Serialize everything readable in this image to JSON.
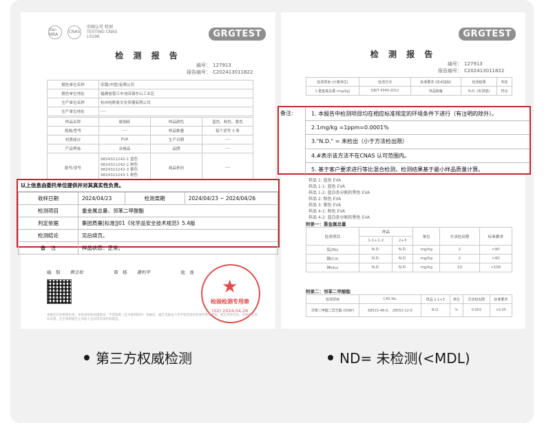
{
  "left_report": {
    "title": "检 测 报 告",
    "brand_logo": "GRGTEST",
    "cert_marks": [
      "ilac-MRA",
      "CNAS",
      "中国认可 检测 TESTING CNAS L0196"
    ],
    "report_no_label": "编号：",
    "report_no": "127913",
    "report_id_label": "报告编号：",
    "report_id": "C202413011822",
    "info_rows": [
      {
        "k": "报告单位名称",
        "v": "安踏(中国)有限公司"
      },
      {
        "k": "报告单位地址",
        "v": "福建省晋江市池店镇东山工业区"
      },
      {
        "k": "生产单位名称",
        "v": "杭州哈默曼文化传播有限公司"
      },
      {
        "k": "生产单位地址",
        "v": "----"
      }
    ],
    "sample_rows": [
      {
        "a": "样品名称",
        "b": "瑜伽砖",
        "c": "样品颜色",
        "d": "蓝色、粉色、紫色"
      },
      {
        "a": "规格/型号",
        "b": "----",
        "c": "样品数量",
        "d": "每个货号 3 条"
      },
      {
        "a": "材质成分",
        "b": "EVA",
        "c": "生产日期",
        "d": "----"
      },
      {
        "a": "产品等级",
        "b": "合格品",
        "c": "品牌",
        "d": "----"
      }
    ],
    "model_label": "款号/货号",
    "model_values": [
      "9824321242-1 蓝色",
      "9824321242-2 粉色",
      "9824321242-3 紫色",
      "9824321243-1 粉色"
    ],
    "trademark_label": "商品条码",
    "trademark_value": "----",
    "highlight_header": "以上信息由委托单位提供并对其真实性负责。",
    "highlight_rows": [
      {
        "k": "收样日期",
        "v": "2024/04/23",
        "k2": "检测周期",
        "v2": "2024/04/23 ~ 2024/04/26"
      },
      {
        "k": "检测项目",
        "v": "重金属总量、邻苯二甲酸酯"
      },
      {
        "k": "判定依据",
        "v": "集团质量[标准]J01《化学品安全技术规范》5.4版"
      },
      {
        "k": "检测结论",
        "v": "见后续页。"
      },
      {
        "k": "备　注",
        "v": "样品状态：正常。"
      }
    ],
    "sign_labels": [
      "编　制",
      "审　核",
      "批　准"
    ],
    "sign_names": [
      "蔡立松",
      "唐利平",
      ""
    ],
    "stamp_text": "检验检测专用章",
    "stamp_num": "(02)",
    "stamp_date": "2024.04.26",
    "footer_text": "本报告仅对来样负责，未经本机构书面批准，不得复制（全文复制除外）本报告。报告无批准人签字或无检验检测专用章无效，报告涂改无效。对本报告有异议者，应于收到报告之日起十五日内向本机构提出。"
  },
  "right_report": {
    "title": "检 测 报 告",
    "brand_logo": "GRGTEST",
    "report_no_label": "编号：",
    "report_no": "127913",
    "report_id_label": "报告编号：",
    "report_id": "C202413011822",
    "top_table_head": [
      "检测项目\n(计量单位)",
      "检测方法",
      "标准要求\n(技术指标)",
      "检测结果",
      "判定"
    ],
    "top_table_row": [
      "1.重金属总量 (mg/kg)",
      "QB/T 4340-2012",
      "样品制备",
      "N.D.\n(实测值)",
      "符合"
    ],
    "note_label": "备注:",
    "notes": [
      "1.  本报告中检测项目均在相应标准规定的环境条件下进行（有注明的除外）。",
      "2.1mg/kg =1ppm=0.0001%",
      "3.\"N.D.\" =  未检出（小于方法检出限）",
      "4.#表示该方法不在CNAS 认可范围内。",
      "5.  基于客户要求进行等比混合检测，检测结果基于最小样品质量计算。"
    ],
    "sample_list": [
      "样品 1: 蓝色 EVA",
      "样品 1-1: 蓝色 EVA",
      "样品 1-2: 蓝白条分割的黑色 EVA",
      "样品 2: 粉色 EVA",
      "样品 3: 紫色 EVA",
      "样品 4-1: 粉色 EVA",
      "样品 4-2: 蓝白条分割的黑色 EVA"
    ],
    "attach1_title": "附录一：重金属总量",
    "attach1_head": [
      "检测项目",
      "样品",
      "单位",
      "方法检出限",
      "标准要求"
    ],
    "attach1_sub": [
      "1-1+1-2",
      "2+3"
    ],
    "attach1_rows": [
      [
        "铅(Pb)",
        "N.D.",
        "N.D.",
        "mg/kg",
        "2",
        "<90"
      ],
      [
        "镉(Cd)",
        "N.D.",
        "N.D.",
        "mg/kg",
        "2",
        "<40"
      ],
      [
        "砷(As)",
        "N.D.",
        "N.D.",
        "mg/kg",
        "10",
        "<100"
      ]
    ],
    "attach2_title": "附录二：邻苯二甲酸酯",
    "attach2_head": [
      "检测项目",
      "CAS No.",
      "样品\n1-1+3",
      "单位",
      "方法检出限",
      "标准要求"
    ],
    "attach2_row": [
      "邻苯二甲酸二异壬酯 (DINP)",
      "68515-48-0、\n28553-12-0",
      "N.D.",
      "%",
      "0.003",
      "<0.05"
    ]
  },
  "captions": [
    "第三方权威检测",
    "ND= 未检测(<MDL)"
  ],
  "colors": {
    "highlight": "#c8232c",
    "panel": "#f1f1f2",
    "stamp": "#e34b4b"
  }
}
